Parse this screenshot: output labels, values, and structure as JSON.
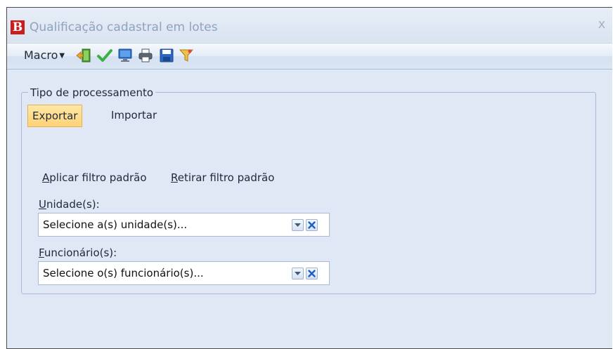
{
  "window": {
    "title": "Qualificação cadastral em lotes",
    "logo_letter": "B",
    "close_glyph": "x"
  },
  "toolbar": {
    "macro_label": "Macro",
    "icons": [
      "exit-door-icon",
      "check-icon",
      "monitor-icon",
      "printer-icon",
      "save-disk-icon",
      "filter-funnel-icon"
    ]
  },
  "group": {
    "legend": "Tipo de processamento",
    "tabs": [
      {
        "label": "Exportar",
        "active": true
      },
      {
        "label": "Importar",
        "active": false
      }
    ]
  },
  "links": {
    "apply_first": "A",
    "apply_rest": "plicar filtro padrão",
    "remove_first": "R",
    "remove_rest": "etirar filtro padrão"
  },
  "fields": {
    "unidade_label_first": "U",
    "unidade_label_rest": "nidade(s):",
    "unidade_placeholder": "Selecione a(s) unidade(s)...",
    "funcionario_label_first": "F",
    "funcionario_label_rest": "uncionário(s):",
    "funcionario_placeholder": "Selecione o(s) funcionário(s)..."
  },
  "colors": {
    "accent_red": "#c81e1e",
    "check_green": "#3cb043",
    "active_tab": "#ffd278"
  }
}
